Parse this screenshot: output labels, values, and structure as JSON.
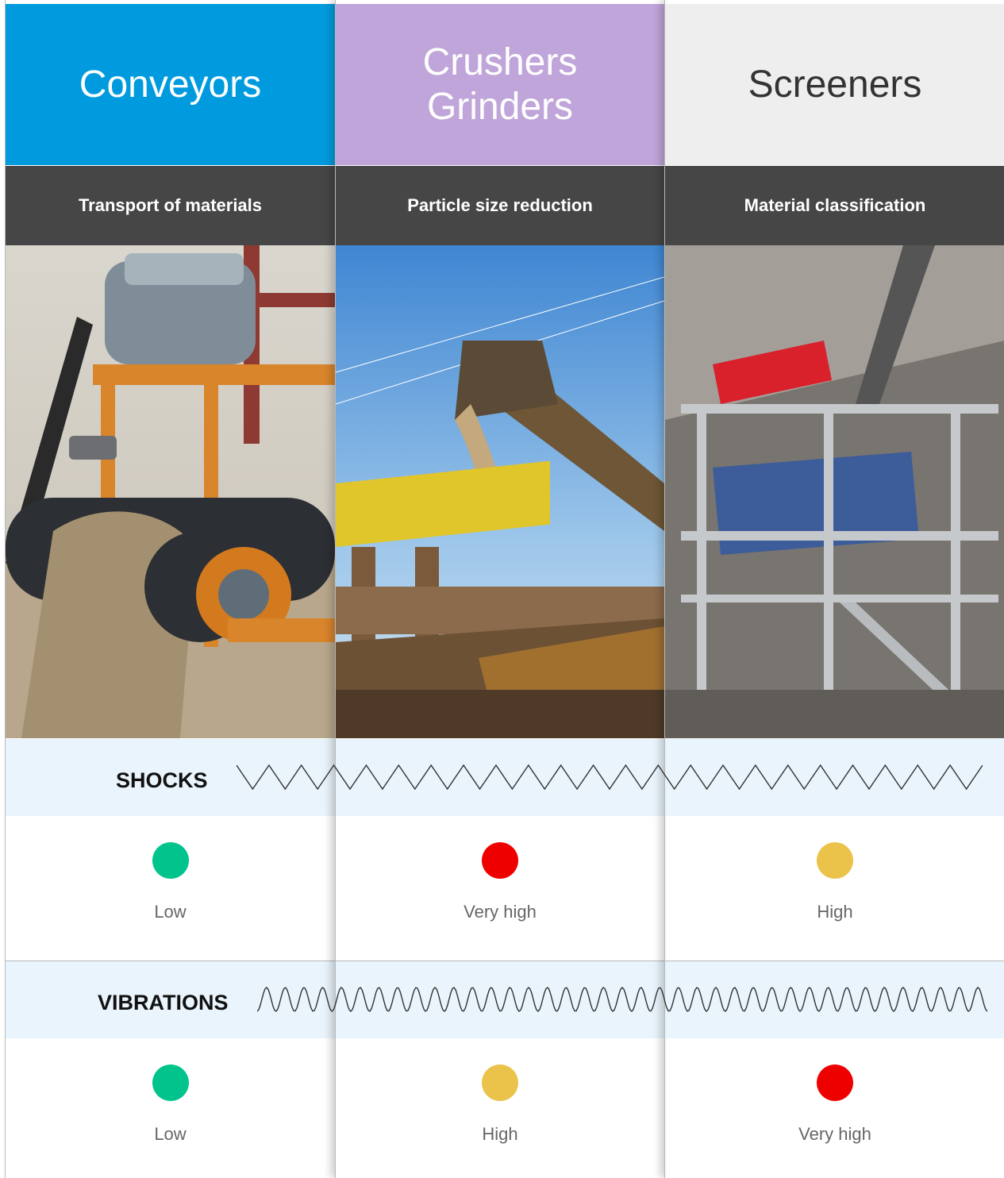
{
  "columns": [
    {
      "title_lines": [
        "Conveyors"
      ],
      "subtitle": "Transport of materials",
      "image": "conveyor-belt-photo",
      "shocks": {
        "level": "Low",
        "color": "#00c48c"
      },
      "vibrations": {
        "level": "Low",
        "color": "#00c48c"
      }
    },
    {
      "title_lines": [
        "Crushers",
        "Grinders"
      ],
      "subtitle": "Particle size reduction",
      "image": "crusher-photo",
      "shocks": {
        "level": "Very high",
        "color": "#ef0000"
      },
      "vibrations": {
        "level": "High",
        "color": "#ebc34a"
      }
    },
    {
      "title_lines": [
        "Screeners"
      ],
      "subtitle": "Material classification",
      "image": "screener-photo",
      "shocks": {
        "level": "High",
        "color": "#ebc34a"
      },
      "vibrations": {
        "level": "Very high",
        "color": "#ef0000"
      }
    }
  ],
  "bands": {
    "shocks": "SHOCKS",
    "vibrations": "VIBRATIONS"
  },
  "colors": {
    "conveyors_header": "#009bde",
    "crushers_header": "#c0a5da",
    "screeners_header": "#eeeeee",
    "subtitle_bar": "#464646",
    "band": "#e9f4fc"
  }
}
